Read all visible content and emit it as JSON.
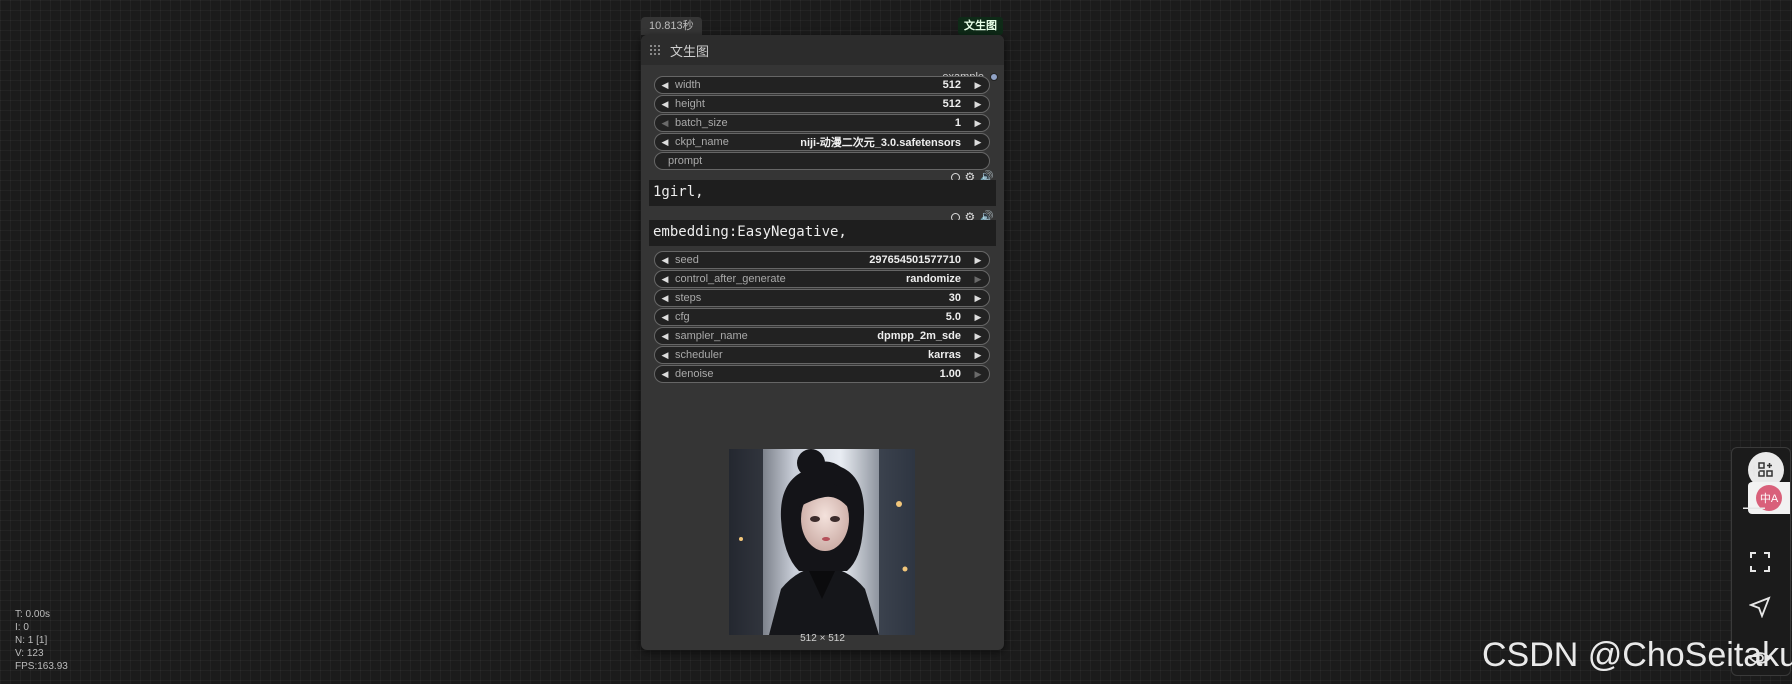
{
  "timing": "10.813秒",
  "node_tag": "文生图",
  "node": {
    "title": "文生图",
    "output_label": "example",
    "widgets": [
      {
        "label": "width",
        "value": "512"
      },
      {
        "label": "height",
        "value": "512"
      },
      {
        "label": "batch_size",
        "value": "1"
      },
      {
        "label": "ckpt_name",
        "value": "niji-动漫二次元_3.0.safetensors"
      }
    ],
    "prompt_label": "prompt",
    "positive_text": "1girl,",
    "negative_text": "embedding:EasyNegative,",
    "sampler_widgets": [
      {
        "label": "seed",
        "value": "297654501577710"
      },
      {
        "label": "control_after_generate",
        "value": "randomize"
      },
      {
        "label": "steps",
        "value": "30"
      },
      {
        "label": "cfg",
        "value": "5.0"
      },
      {
        "label": "sampler_name",
        "value": "dpmpp_2m_sde"
      },
      {
        "label": "scheduler",
        "value": "karras"
      },
      {
        "label": "denoise",
        "value": "1.00"
      }
    ],
    "preview_caption": "512 × 512"
  },
  "stats": [
    "T: 0.00s",
    "I: 0",
    "N: 1 [1]",
    "V: 123",
    "FPS:163.93"
  ],
  "toolbar_icons": [
    "apps-add-icon",
    "zoom-in-icon",
    "translate-icon",
    "zoom-out-icon",
    "fit-view-icon",
    "send-icon",
    "eye-icon"
  ],
  "watermark": "CSDN @ChoSeitaku"
}
